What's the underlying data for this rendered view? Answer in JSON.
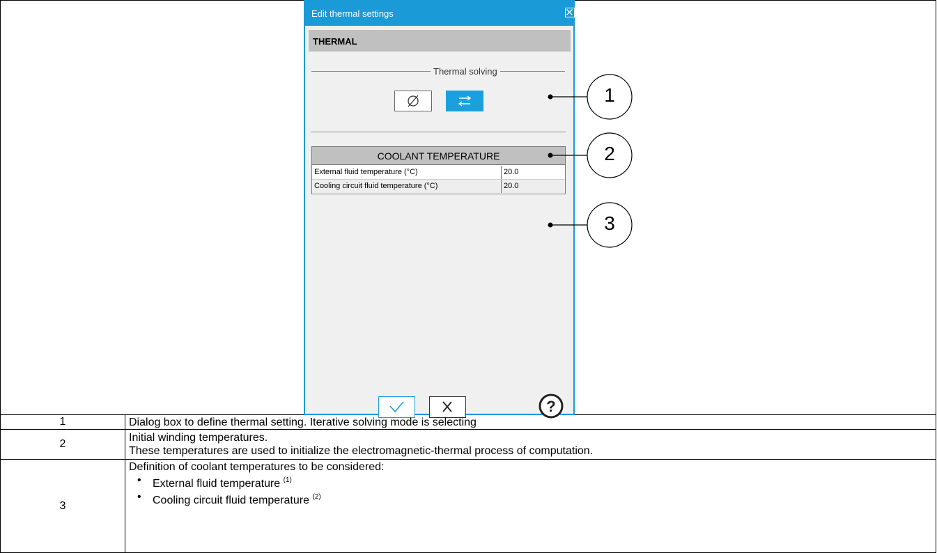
{
  "dialog": {
    "title": "Edit thermal settings",
    "section": "THERMAL",
    "solving_group": "Thermal solving",
    "modes": [
      {
        "name": "none",
        "symbol": "Ø",
        "selected": false
      },
      {
        "name": "iterative",
        "symbol": "⇄",
        "selected": true
      }
    ],
    "accent_color": "#1a9ad6",
    "coolant": {
      "header": "COOLANT TEMPERATURE",
      "rows": [
        {
          "label": "External fluid temperature (°C)",
          "value": "20.0"
        },
        {
          "label": "Cooling circuit fluid temperature (°C)",
          "value": "20.0"
        }
      ]
    },
    "ok_icon": "check-icon",
    "cancel_icon": "close-icon",
    "help_symbol": "?"
  },
  "callouts": [
    "1",
    "2",
    "3"
  ],
  "table": {
    "rows": [
      {
        "num": "1",
        "lines": [
          "Dialog box to define thermal setting. Iterative solving mode is selecting"
        ]
      },
      {
        "num": "2",
        "lines": [
          "Initial winding temperatures.",
          "These temperatures are used to initialize the electromagnetic-thermal process of computation."
        ]
      },
      {
        "num": "3",
        "intro": "Definition of coolant temperatures to be considered:",
        "bullets": [
          {
            "text": "External fluid temperature ",
            "note": "(1)"
          },
          {
            "text": "Cooling circuit fluid temperature ",
            "note": "(2)"
          }
        ]
      }
    ]
  }
}
